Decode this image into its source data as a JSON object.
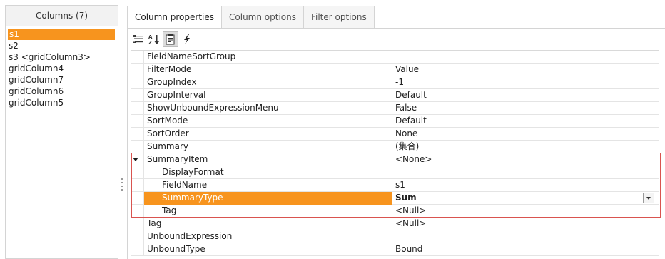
{
  "columns_panel": {
    "header": "Columns (7)",
    "items": [
      "s1",
      "s2",
      "s3 <gridColumn3>",
      "gridColumn4",
      "gridColumn7",
      "gridColumn6",
      "gridColumn5"
    ],
    "selected_index": 0
  },
  "tabs": [
    {
      "label": "Column properties",
      "active": true
    },
    {
      "label": "Column options",
      "active": false
    },
    {
      "label": "Filter options",
      "active": false
    }
  ],
  "toolbar": {
    "buttons": [
      {
        "icon": "categorized-icon",
        "pressed": false
      },
      {
        "icon": "sort-alphabetical-icon",
        "pressed": false
      },
      {
        "icon": "property-pages-icon",
        "pressed": true
      },
      {
        "icon": "events-lightning-icon",
        "pressed": false
      }
    ]
  },
  "properties": [
    {
      "name": "FieldNameSortGroup",
      "value": ""
    },
    {
      "name": "FilterMode",
      "value": "Value"
    },
    {
      "name": "GroupIndex",
      "value": "-1"
    },
    {
      "name": "GroupInterval",
      "value": "Default"
    },
    {
      "name": "ShowUnboundExpressionMenu",
      "value": "False"
    },
    {
      "name": "SortMode",
      "value": "Default"
    },
    {
      "name": "SortOrder",
      "value": "None"
    },
    {
      "name": "Summary",
      "value": "(集合)"
    },
    {
      "name": "SummaryItem",
      "value": "<None>",
      "expanded": true
    },
    {
      "name": "DisplayFormat",
      "value": "",
      "child": true
    },
    {
      "name": "FieldName",
      "value": "s1",
      "child": true
    },
    {
      "name": "SummaryType",
      "value": "Sum",
      "child": true,
      "selected": true,
      "dropdown": true
    },
    {
      "name": "Tag",
      "value": "<Null>",
      "child": true
    },
    {
      "name": "Tag",
      "value": "<Null>"
    },
    {
      "name": "UnboundExpression",
      "value": ""
    },
    {
      "name": "UnboundType",
      "value": "Bound"
    }
  ],
  "colors": {
    "selection": "#f7941e",
    "highlight_border": "#d9534f"
  }
}
